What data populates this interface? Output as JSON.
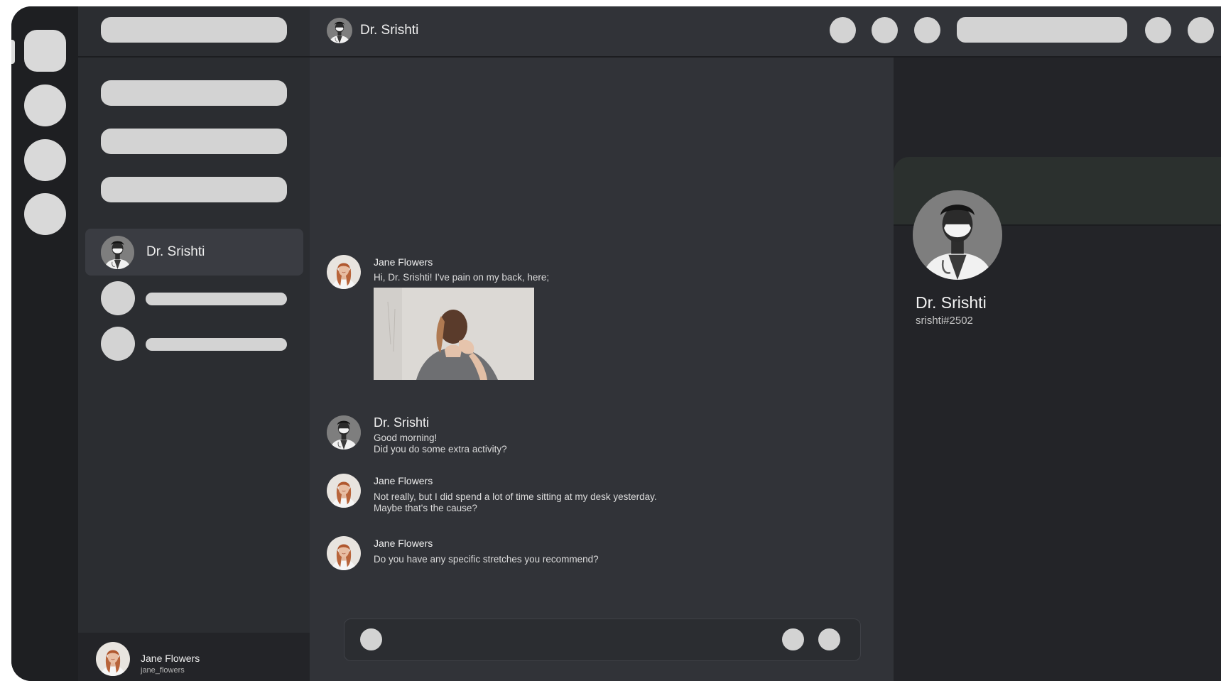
{
  "channel": {
    "title": "Dr. Srishti"
  },
  "sidebar": {
    "active_dm": {
      "name": "Dr. Srishti"
    },
    "current_user": {
      "name": "Jane Flowers",
      "username": "jane_flowers"
    }
  },
  "messages": [
    {
      "author": "Jane Flowers",
      "lines": [
        "Hi, Dr. Srishti! I've pain on my back, here;"
      ],
      "has_image": true
    },
    {
      "author": "Dr. Srishti",
      "lines": [
        "Good morning!",
        "Did you do some extra activity?"
      ]
    },
    {
      "author": "Jane Flowers",
      "lines": [
        "Not really, but I did spend a lot of time sitting at my desk yesterday.",
        "Maybe that's the cause?"
      ]
    },
    {
      "author": "Jane Flowers",
      "lines": [
        "Do you have any specific stretches you recommend?"
      ]
    }
  ],
  "profile": {
    "name": "Dr. Srishti",
    "tag": "srishti#2502"
  },
  "colors": {
    "background": "#313338",
    "sidebar": "#2b2d31",
    "rail": "#1e1f22",
    "placeholder": "#d3d3d3"
  },
  "icons": {
    "doctor_avatar": "doctor-avatar",
    "patient_avatar": "patient-avatar"
  }
}
